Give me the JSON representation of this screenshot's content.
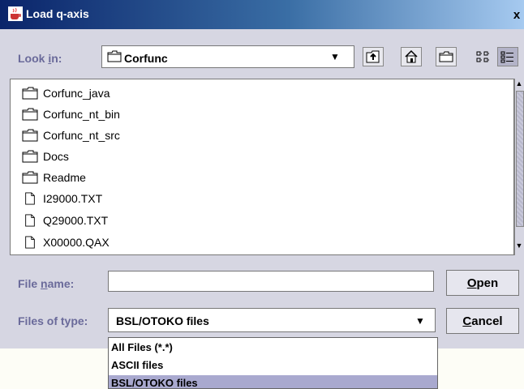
{
  "window": {
    "title": "Load q-axis",
    "close_label": "x"
  },
  "look_in": {
    "label_pre": "Look ",
    "label_mnemonic": "i",
    "label_post": "n:",
    "value": "Corfunc"
  },
  "toolbar": [
    "up-one-level-icon",
    "home-icon",
    "new-folder-icon",
    "list-view-icon",
    "details-view-icon"
  ],
  "files": [
    {
      "name": "Corfunc_java",
      "type": "folder"
    },
    {
      "name": "Corfunc_nt_bin",
      "type": "folder"
    },
    {
      "name": "Corfunc_nt_src",
      "type": "folder"
    },
    {
      "name": "Docs",
      "type": "folder"
    },
    {
      "name": "Readme",
      "type": "folder"
    },
    {
      "name": "I29000.TXT",
      "type": "file"
    },
    {
      "name": "Q29000.TXT",
      "type": "file"
    },
    {
      "name": "X00000.QAX",
      "type": "file"
    }
  ],
  "file_name": {
    "label_pre": "File ",
    "label_mnemonic": "n",
    "label_post": "ame:",
    "value": ""
  },
  "files_of_type": {
    "label": "Files of type:",
    "value": "BSL/OTOKO files"
  },
  "buttons": {
    "open_mnemonic": "O",
    "open_rest": "pen",
    "cancel_mnemonic": "C",
    "cancel_rest": "ancel"
  },
  "type_options": [
    {
      "label": "All Files (*.*)",
      "selected": false
    },
    {
      "label": "ASCII files",
      "selected": false
    },
    {
      "label": "BSL/OTOKO files",
      "selected": true
    }
  ],
  "colors": {
    "title_bar_start": "#0a246a",
    "dialog_bg": "#d6d6e2",
    "label": "#6a6a9a",
    "selection": "#a9a9cf"
  }
}
